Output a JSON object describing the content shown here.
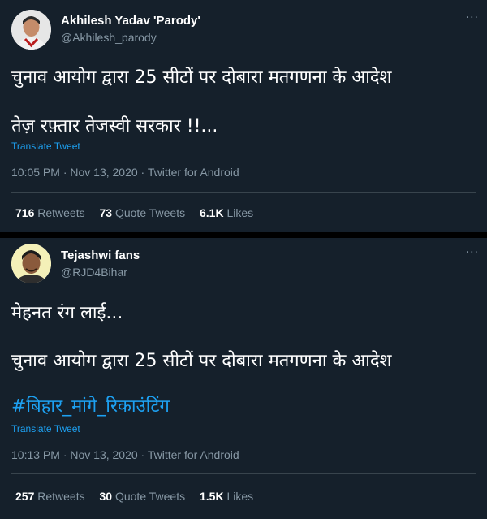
{
  "tweets": [
    {
      "name": "Akhilesh Yadav 'Parody'",
      "handle": "@Akhilesh_parody",
      "more": "···",
      "lines": [
        "चुनाव आयोग द्वारा 25 सीटों पर दोबारा मतगणना के आदेश",
        "तेज़ रफ़्तार तेजस्वी सरकार !!..."
      ],
      "translate": "Translate Tweet",
      "time": "10:05 PM · Nov 13, 2020 · Twitter for Android",
      "retweets_count": "716",
      "retweets_label": "Retweets",
      "quotes_count": "73",
      "quotes_label": "Quote Tweets",
      "likes_count": "6.1K",
      "likes_label": "Likes"
    },
    {
      "name": "Tejashwi fans",
      "handle": "@RJD4Bihar",
      "more": "···",
      "lines": [
        "मेहनत रंग लाई...",
        "चुनाव आयोग द्वारा 25 सीटों पर दोबारा मतगणना के आदेश"
      ],
      "hashtag": "#बिहार_मांगे_रिकाउंटिंग",
      "translate": "Translate Tweet",
      "time": "10:13 PM · Nov 13, 2020 · Twitter for Android",
      "retweets_count": "257",
      "retweets_label": "Retweets",
      "quotes_count": "30",
      "quotes_label": "Quote Tweets",
      "likes_count": "1.5K",
      "likes_label": "Likes"
    }
  ],
  "colors": {
    "background": "#15202b",
    "link": "#1da1f2",
    "muted": "#8899a6"
  }
}
